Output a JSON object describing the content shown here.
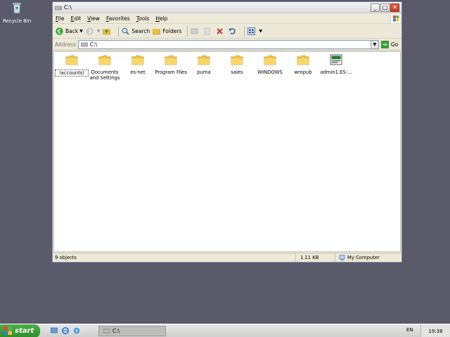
{
  "desktop": {
    "recycle_bin_label": "Recycle Bin"
  },
  "window": {
    "title": "C:\\",
    "menu": [
      {
        "label": "File",
        "accel": "F",
        "rest": "ile"
      },
      {
        "label": "Edit",
        "accel": "E",
        "rest": "dit"
      },
      {
        "label": "View",
        "accel": "V",
        "rest": "iew"
      },
      {
        "label": "Favorites",
        "accel": "F",
        "rest": "avorites"
      },
      {
        "label": "Tools",
        "accel": "T",
        "rest": "ools"
      },
      {
        "label": "Help",
        "accel": "H",
        "rest": "elp"
      }
    ],
    "toolbar": {
      "back_label": "Back",
      "search_label": "Search",
      "folders_label": "Folders"
    },
    "address": {
      "label": "Address",
      "value": "C:\\",
      "go_label": "Go"
    },
    "items": [
      {
        "label": "!accounts!",
        "type": "folder",
        "selected": true
      },
      {
        "label": "Documents and Settings",
        "type": "folder"
      },
      {
        "label": "es-net",
        "type": "folder"
      },
      {
        "label": "Program Files",
        "type": "folder"
      },
      {
        "label": "puma",
        "type": "folder"
      },
      {
        "label": "sales",
        "type": "folder"
      },
      {
        "label": "WINDOWS",
        "type": "folder"
      },
      {
        "label": "wmpub",
        "type": "folder"
      },
      {
        "label": "admin1.ES-...",
        "type": "file"
      }
    ],
    "status": {
      "objects": "9 objects",
      "size": "1.11 KB",
      "zone": "My Computer"
    }
  },
  "taskbar": {
    "start_label": "start",
    "task_label": "C:\\",
    "language": "EN",
    "clock": "19:38"
  },
  "colors": {
    "desktop": "#5a5a6b",
    "folder": "#f0c040",
    "start_green": "#3c9e38"
  }
}
